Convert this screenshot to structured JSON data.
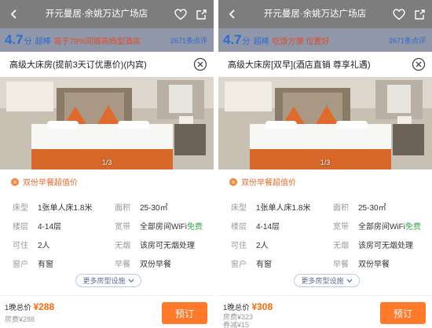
{
  "panels": [
    {
      "hotel_title": "开元曼居·余姚万达广场店",
      "rating": {
        "score": "4.7",
        "unit": "分",
        "grade": "超棒",
        "tagline": "高于78%同城高档型酒店",
        "reviews": "2671条点评"
      },
      "room_name": "高级大床房(提前3天订优惠价)(内宾)",
      "photo_counter": "1/3",
      "meal": "双份早餐超值价",
      "specs": [
        {
          "key": "床型",
          "value": "1张单人床1.8米"
        },
        {
          "key": "面积",
          "value": "25-30㎡"
        },
        {
          "key": "楼层",
          "value": "4-14层"
        },
        {
          "key": "宽带",
          "value": "全部房间WiFi",
          "extra": "免费"
        },
        {
          "key": "可住",
          "value": "2人"
        },
        {
          "key": "无烟",
          "value": "该房可无烟处理"
        },
        {
          "key": "窗户",
          "value": "有窗"
        },
        {
          "key": "早餐",
          "value": "双份早餐"
        }
      ],
      "more_label": "更多房型设施",
      "total_label": "1晚总价",
      "currency": "¥",
      "total_price": "288",
      "sub_lines": [
        "房费¥288"
      ],
      "book_label": "预订"
    },
    {
      "hotel_title": "开元曼居·余姚万达广场店",
      "rating": {
        "score": "4.7",
        "unit": "分",
        "grade": "超棒",
        "tagline": "吃饭方便 位置好",
        "reviews": "2671条点评"
      },
      "room_name": "高级大床房[双早](酒店直销 尊享礼遇)",
      "photo_counter": "1/3",
      "meal": "双份早餐超值价",
      "specs": [
        {
          "key": "床型",
          "value": "1张单人床1.8米"
        },
        {
          "key": "面积",
          "value": "25-30㎡"
        },
        {
          "key": "楼层",
          "value": "4-14层"
        },
        {
          "key": "宽带",
          "value": "全部房间WiFi",
          "extra": "免费"
        },
        {
          "key": "可住",
          "value": "2人"
        },
        {
          "key": "无烟",
          "value": "该房可无烟处理"
        },
        {
          "key": "窗户",
          "value": "有窗"
        },
        {
          "key": "早餐",
          "value": "双份早餐"
        }
      ],
      "more_label": "更多房型设施",
      "total_label": "1晚总价",
      "currency": "¥",
      "total_price": "308",
      "sub_lines": [
        "房费¥323",
        "券减¥15"
      ],
      "book_label": "预订"
    }
  ],
  "colors": {
    "accent_orange": "#ff7a2a",
    "price_orange": "#ff6a00",
    "score_blue": "#2c6bd6",
    "tagline_red": "#e24b26",
    "free_green": "#3aa64a"
  },
  "icons": [
    "back-arrow-icon",
    "heart-icon",
    "share-icon",
    "close-circle-icon",
    "breakfast-icon",
    "chevron-down-icon"
  ]
}
